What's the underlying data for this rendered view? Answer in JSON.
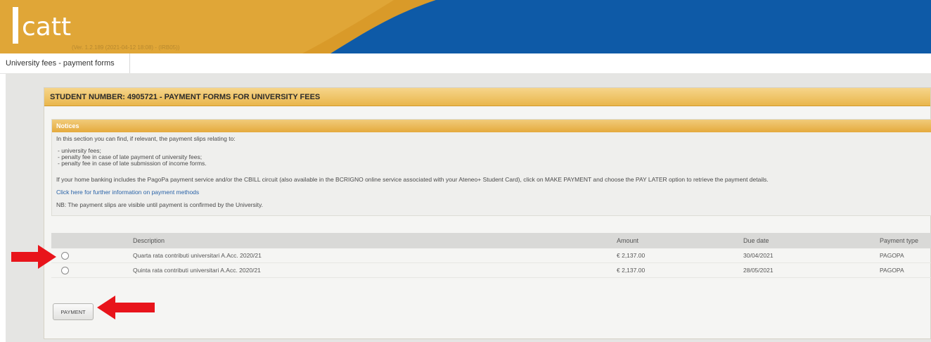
{
  "header": {
    "logo_text": "catt",
    "version": "(Ver. 1.2.189 (2021-04-12 18:08) - (IRB05))"
  },
  "tabs": [
    {
      "label": "University fees - payment forms"
    }
  ],
  "panel": {
    "title": "STUDENT NUMBER: 4905721 - PAYMENT FORMS FOR UNIVERSITY FEES"
  },
  "notices": {
    "title": "Notices",
    "intro": "In this section you can find, if relevant, the payment slips relating to:",
    "items": [
      "- university fees;",
      "- penalty fee in case of late payment of university fees;",
      "- penalty fee in case of late submission of income forms."
    ],
    "info": "If your home banking includes the PagoPa payment service and/or the CBILL circuit (also available in the BCRIGNO online service associated with your Ateneo+ Student Card), click on MAKE PAYMENT and choose the PAY LATER option to retrieve the payment details.",
    "link": "Click here for further information on payment methods",
    "nb": "NB: The payment slips are visible until payment is confirmed by the University."
  },
  "table": {
    "headers": {
      "description": "Description",
      "amount": "Amount",
      "due_date": "Due date",
      "payment_type": "Payment type"
    },
    "rows": [
      {
        "description": "Quarta rata contributi universitari A.Acc. 2020/21",
        "amount": "€ 2,137.00",
        "due_date": "30/04/2021",
        "payment_type": "PAGOPA"
      },
      {
        "description": "Quinta rata contributi universitari A.Acc. 2020/21",
        "amount": "€ 2,137.00",
        "due_date": "28/05/2021",
        "payment_type": "PAGOPA"
      }
    ]
  },
  "actions": {
    "payment_label": "PAYMENT"
  },
  "colors": {
    "accent_gold": "#e9b64c",
    "brand_blue": "#0d5aa8",
    "arrow_red": "#e8141b"
  }
}
